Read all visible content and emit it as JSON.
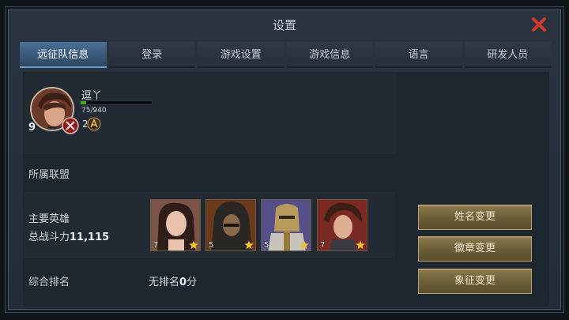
{
  "window": {
    "title": "设置"
  },
  "tabs": [
    {
      "label": "远征队信息",
      "active": true
    },
    {
      "label": "登录"
    },
    {
      "label": "游戏设置"
    },
    {
      "label": "游戏信息"
    },
    {
      "label": "语言"
    },
    {
      "label": "研发人员"
    }
  ],
  "profile": {
    "name": "逗丫",
    "level": "9",
    "exp_text": "75/940",
    "exp_fraction": 0.08,
    "rank_number": "2"
  },
  "alliance": {
    "label": "所属联盟"
  },
  "heroes": {
    "label": "主要英雄",
    "power_label": "总战斗力",
    "power_value": "11,115",
    "list": [
      {
        "level": "7",
        "icon": "heroine-portrait"
      },
      {
        "level": "5",
        "icon": "hooded-warrior-portrait"
      },
      {
        "level": "5",
        "icon": "golden-knight-portrait"
      },
      {
        "level": "7",
        "icon": "young-hero-portrait"
      }
    ]
  },
  "ranking": {
    "label": "综合排名",
    "value_prefix": "无排名",
    "value_score": "0",
    "value_suffix": "分"
  },
  "buttons": {
    "rename": "姓名变更",
    "badge_change": "徽章变更",
    "symbol_change": "象征变更"
  },
  "colors": {
    "accent_tab": "#4a6f93",
    "button_gold": "#8a7a4e",
    "close_red": "#d13a2a",
    "exp_green": "#3ea81f"
  }
}
